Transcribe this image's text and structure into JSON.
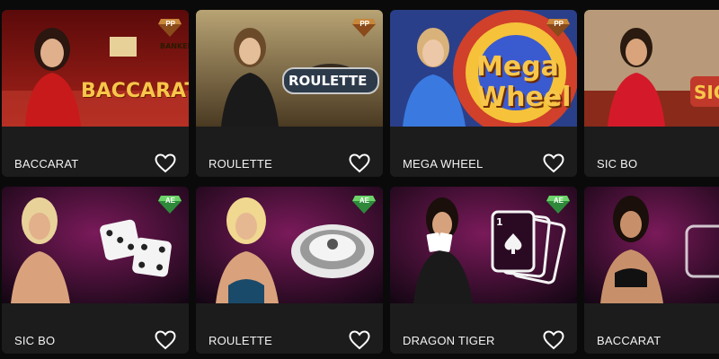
{
  "cards": [
    {
      "title": "BACCARAT",
      "provider": "PP",
      "logo": "BACCARAT",
      "logo_small": "BANKER",
      "theme": "#7a0f0f"
    },
    {
      "title": "ROULETTE",
      "provider": "PP",
      "logo": "ROULETTE",
      "theme": "#6b5a3a"
    },
    {
      "title": "MEGA WHEEL",
      "provider": "PP",
      "logo_line1": "Mega",
      "logo_line2": "Wheel",
      "theme": "#3a4fa8"
    },
    {
      "title": "SIC BO",
      "provider": "PP",
      "logo": "SIC",
      "theme": "#7a1a12"
    },
    {
      "title": "SIC BO",
      "provider": "AE",
      "theme": "#2a0a22"
    },
    {
      "title": "ROULETTE",
      "provider": "AE",
      "theme": "#2a0a22"
    },
    {
      "title": "DRAGON TIGER",
      "provider": "AE",
      "card_corner": "1",
      "theme": "#2a0a22"
    },
    {
      "title": "BACCARAT",
      "provider": "AE",
      "theme": "#2a0a22"
    }
  ],
  "colors": {
    "pp_badge": "#8a4a1a",
    "ae_badge": "#4caf50",
    "card_bg": "#1c1c1c"
  },
  "icons": {
    "favorite": "heart-outline-icon",
    "pp_badge": "diamond-pp-icon",
    "ae_badge": "diamond-ae-icon"
  }
}
